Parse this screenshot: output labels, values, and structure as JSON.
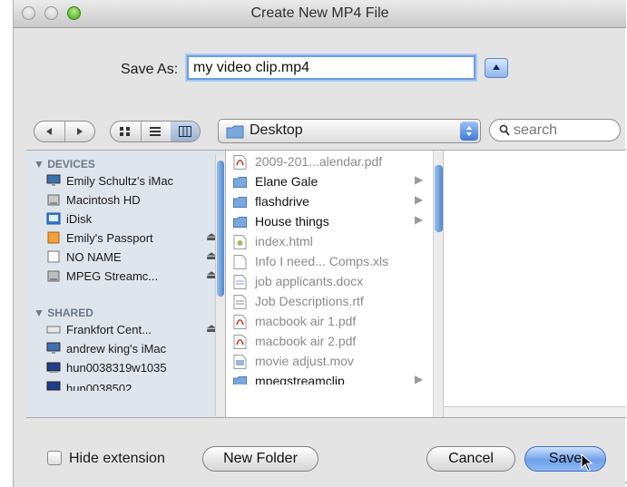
{
  "window": {
    "title": "Create New MP4 File"
  },
  "save_as": {
    "label": "Save As:",
    "value": "my video clip.mp4"
  },
  "toolbar": {
    "location": "Desktop",
    "search_placeholder": "search",
    "active_view": "columns"
  },
  "sidebar": {
    "sections": [
      {
        "header": "DEVICES",
        "items": [
          {
            "label": "Emily Schultz's iMac",
            "icon": "imac-icon",
            "eject": false
          },
          {
            "label": "Macintosh HD",
            "icon": "hard-drive-icon",
            "eject": false
          },
          {
            "label": "iDisk",
            "icon": "idisk-icon",
            "eject": false
          },
          {
            "label": "Emily's Passport",
            "icon": "external-drive-icon",
            "eject": true
          },
          {
            "label": "NO NAME",
            "icon": "removable-disk-icon",
            "eject": true
          },
          {
            "label": "MPEG Streamc...",
            "icon": "disk-image-icon",
            "eject": true
          }
        ]
      },
      {
        "header": "SHARED",
        "items": [
          {
            "label": "Frankfort Cent...",
            "icon": "network-share-icon",
            "eject": true
          },
          {
            "label": "andrew king's iMac",
            "icon": "imac-icon",
            "eject": false
          },
          {
            "label": "hun0038319w1035",
            "icon": "computer-icon",
            "eject": false
          },
          {
            "label": "hun0038502",
            "icon": "computer-icon",
            "eject": false
          }
        ]
      }
    ],
    "eject_glyph": "⏏"
  },
  "files": [
    {
      "label": "2009-201...alendar.pdf",
      "type": "pdf",
      "folder": false
    },
    {
      "label": "Elane Gale",
      "type": "folder",
      "folder": true
    },
    {
      "label": "flashdrive",
      "type": "folder",
      "folder": true
    },
    {
      "label": "House things",
      "type": "folder",
      "folder": true
    },
    {
      "label": "index.html",
      "type": "html",
      "folder": false
    },
    {
      "label": "Info I need... Comps.xls",
      "type": "doc",
      "folder": false
    },
    {
      "label": "job applicants.docx",
      "type": "doc",
      "folder": false
    },
    {
      "label": "Job Descriptions.rtf",
      "type": "doc",
      "folder": false
    },
    {
      "label": "macbook air 1.pdf",
      "type": "pdf",
      "folder": false
    },
    {
      "label": "macbook air 2.pdf",
      "type": "pdf",
      "folder": false
    },
    {
      "label": "movie adjust.mov",
      "type": "movie",
      "folder": false
    },
    {
      "label": "mpegstreamclip",
      "type": "folder",
      "folder": true
    }
  ],
  "footer": {
    "hide_extension_label": "Hide extension",
    "hide_extension_checked": false,
    "new_folder_label": "New Folder",
    "cancel_label": "Cancel",
    "save_label": "Save"
  },
  "colors": {
    "accent": "#6fa1ea",
    "sidebar_bg": "#dfe5ed",
    "folder_blue": "#7aa7dd",
    "pdf_red": "#c8362b"
  }
}
